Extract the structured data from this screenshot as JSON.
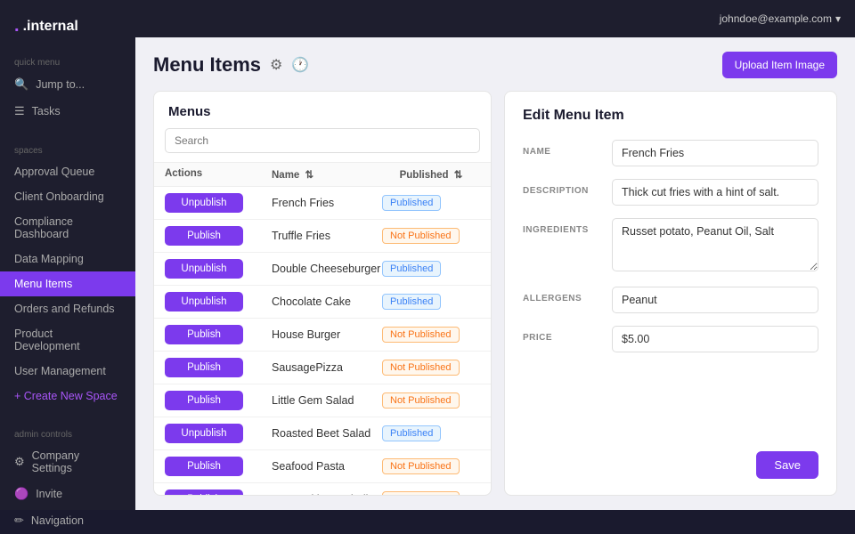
{
  "app": {
    "name": ".internal",
    "logo_dot": "."
  },
  "topbar": {
    "user": "johndoe@example.com",
    "chevron": "▾"
  },
  "sidebar": {
    "quick_menu_label": "Quick menu",
    "jump_to": "Jump to...",
    "tasks": "Tasks",
    "spaces_label": "Spaces",
    "items": [
      {
        "id": "approval-queue",
        "label": "Approval Queue",
        "active": false
      },
      {
        "id": "client-onboarding",
        "label": "Client Onboarding",
        "active": false
      },
      {
        "id": "compliance-dashboard",
        "label": "Compliance Dashboard",
        "active": false
      },
      {
        "id": "data-mapping",
        "label": "Data Mapping",
        "active": false
      },
      {
        "id": "menu-items",
        "label": "Menu Items",
        "active": true
      },
      {
        "id": "orders-and-refunds",
        "label": "Orders and Refunds",
        "active": false
      },
      {
        "id": "product-development",
        "label": "Product Development",
        "active": false
      },
      {
        "id": "user-management",
        "label": "User Management",
        "active": false
      }
    ],
    "create_new_space": "+ Create New Space",
    "admin_controls_label": "Admin controls",
    "company_settings": "Company Settings",
    "invite": "Invite",
    "navigation": "Navigation"
  },
  "page": {
    "title": "Menu Items",
    "upload_button": "Upload Item Image"
  },
  "menus_panel": {
    "title": "Menus",
    "search_placeholder": "Search",
    "columns": {
      "actions": "Actions",
      "name": "Name",
      "published": "Published"
    },
    "rows": [
      {
        "id": 1,
        "action": "Unpublish",
        "name": "French Fries",
        "status": "Published",
        "published": true
      },
      {
        "id": 2,
        "action": "Publish",
        "name": "Truffle Fries",
        "status": "Not Published",
        "published": false
      },
      {
        "id": 3,
        "action": "Unpublish",
        "name": "Double Cheeseburger",
        "status": "Published",
        "published": true
      },
      {
        "id": 4,
        "action": "Unpublish",
        "name": "Chocolate Cake",
        "status": "Published",
        "published": true
      },
      {
        "id": 5,
        "action": "Publish",
        "name": "House Burger",
        "status": "Not Published",
        "published": false
      },
      {
        "id": 6,
        "action": "Publish",
        "name": "SausagePizza",
        "status": "Not Published",
        "published": false
      },
      {
        "id": 7,
        "action": "Publish",
        "name": "Little Gem Salad",
        "status": "Not Published",
        "published": false
      },
      {
        "id": 8,
        "action": "Unpublish",
        "name": "Roasted Beet Salad",
        "status": "Published",
        "published": true
      },
      {
        "id": 9,
        "action": "Publish",
        "name": "Seafood Pasta",
        "status": "Not Published",
        "published": false
      },
      {
        "id": 10,
        "action": "Publish",
        "name": "Pasta with Meatballs",
        "status": "Not Published",
        "published": false
      }
    ]
  },
  "edit_panel": {
    "title": "Edit Menu Item",
    "fields": {
      "name_label": "NAME",
      "name_value": "French Fries",
      "description_label": "DESCRIPTION",
      "description_value": "Thick cut fries with a hint of salt.",
      "ingredients_label": "INGREDIENTS",
      "ingredients_value": "Russet potato, Peanut Oil, Salt",
      "allergens_label": "ALLERGENS",
      "allergens_value": "Peanut",
      "price_label": "PRICE",
      "price_value": "$5.00"
    },
    "save_button": "Save"
  }
}
